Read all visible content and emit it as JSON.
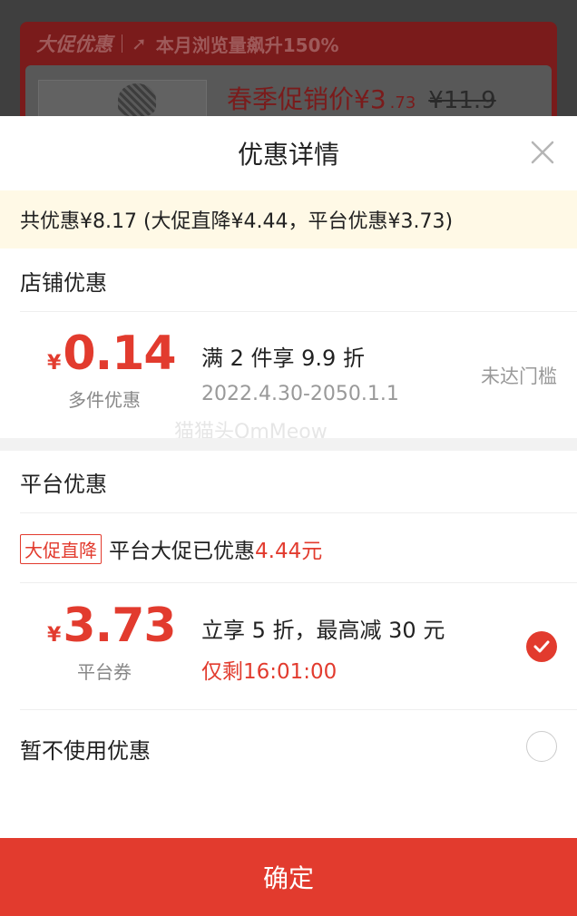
{
  "background": {
    "banner_brand": "大促优惠",
    "banner_text": "本月浏览量飙升150%",
    "price_prefix": "春季促销价¥3",
    "price_decimal": ".73",
    "original_price": "¥11.9"
  },
  "sheet": {
    "title": "优惠详情",
    "summary": "共优惠¥8.17 (大促直降¥4.44，平台优惠¥3.73)"
  },
  "store": {
    "section_title": "店铺优惠",
    "coupon": {
      "currency": "¥",
      "amount": "0.14",
      "label": "多件优惠",
      "description": "满 2 件享 9.9 折",
      "validity": "2022.4.30-2050.1.1",
      "status": "未达门槛"
    }
  },
  "watermark": "猫猫头OmMeow",
  "platform": {
    "section_title": "平台优惠",
    "promo_tag": "大促直降",
    "promo_text": "平台大促已优惠",
    "promo_amount": "4.44元",
    "coupon": {
      "currency": "¥",
      "amount": "3.73",
      "label": "平台券",
      "description": "立享 5 折，最高减 30 元",
      "countdown": "仅剩16:01:00",
      "selected": true
    }
  },
  "no_discount": {
    "label": "暂不使用优惠",
    "selected": false
  },
  "confirm_label": "确定",
  "colors": {
    "accent": "#e23b2e",
    "summary_bg": "#fff9e6"
  }
}
